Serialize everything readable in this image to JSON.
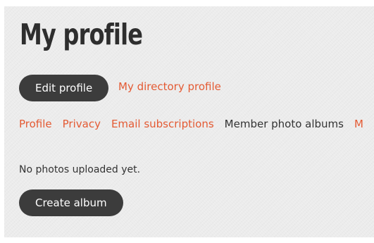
{
  "header": {
    "title": "My profile"
  },
  "actions": {
    "edit_profile_label": "Edit profile",
    "directory_profile_label": "My directory profile"
  },
  "tabs": [
    {
      "label": "Profile"
    },
    {
      "label": "Privacy"
    },
    {
      "label": "Email subscriptions"
    },
    {
      "label": "Member photo albums"
    },
    {
      "label": "M"
    }
  ],
  "albums": {
    "empty_message": "No photos uploaded yet.",
    "create_label": "Create album"
  },
  "colors": {
    "accent": "#e45a33",
    "button_bg": "#3c3c3c",
    "text": "#333333",
    "panel_bg": "#ececec"
  }
}
